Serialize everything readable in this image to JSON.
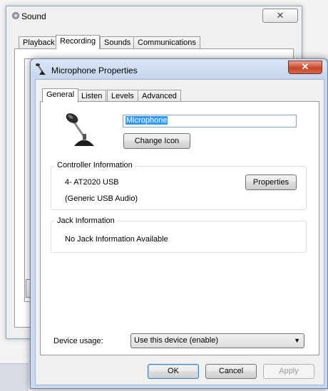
{
  "sound_window": {
    "title": "Sound",
    "close_glyph": "✕",
    "tabs": [
      "Playback",
      "Recording",
      "Sounds",
      "Communications"
    ],
    "active_tab": "Recording"
  },
  "mic_window": {
    "title": "Microphone Properties",
    "close_glyph": "✕",
    "tabs": [
      "General",
      "Listen",
      "Levels",
      "Advanced"
    ],
    "active_tab": "General",
    "device_name": "Microphone",
    "change_icon_label": "Change Icon",
    "controller_info": {
      "legend": "Controller Information",
      "line1": "4- AT2020 USB",
      "line2": "(Generic USB Audio)",
      "properties_label": "Properties"
    },
    "jack_info": {
      "legend": "Jack Information",
      "text": "No Jack Information Available"
    },
    "device_usage": {
      "label": "Device usage:",
      "selected": "Use this device (enable)",
      "arrow": "▼"
    },
    "footer": {
      "ok_label": "OK",
      "cancel_label": "Cancel",
      "apply_label": "Apply"
    }
  },
  "colors": {
    "selection": "#3399ff",
    "title_bar": "#c9d9ef",
    "close_button": "#c84529"
  }
}
